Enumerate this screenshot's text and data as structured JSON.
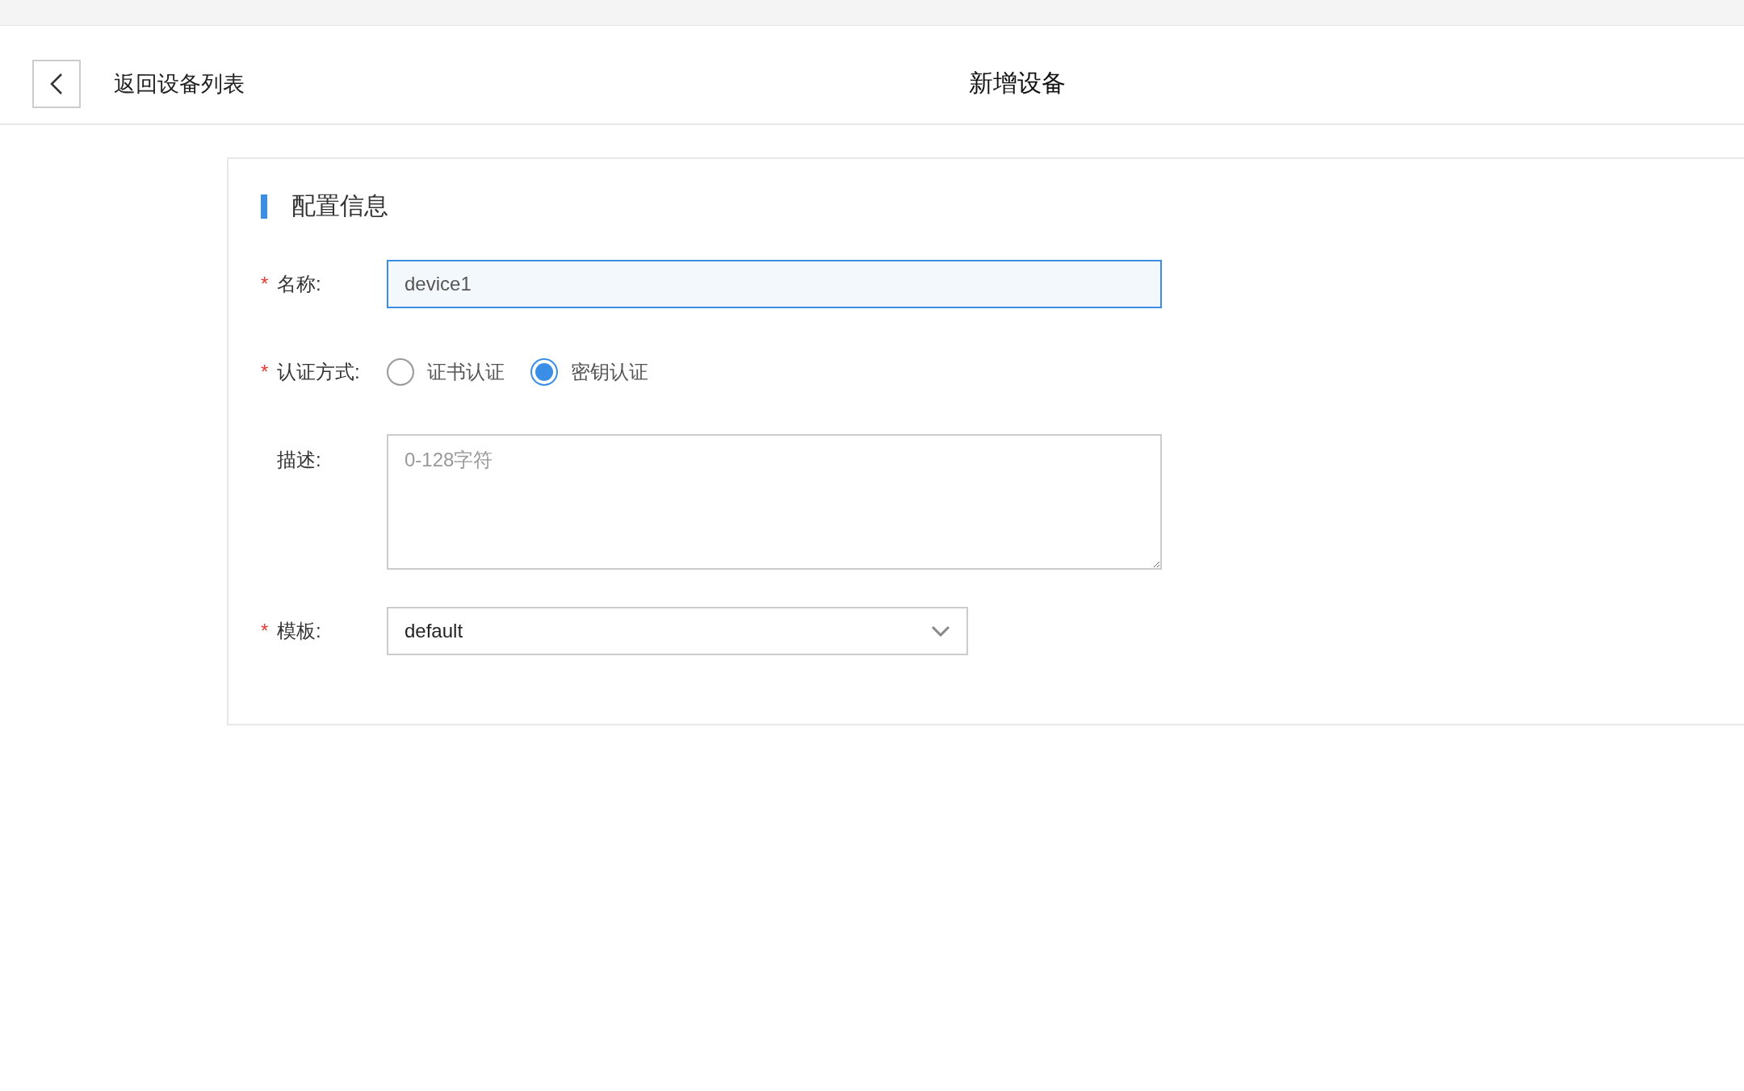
{
  "header": {
    "back_label": "返回设备列表",
    "title": "新增设备"
  },
  "section": {
    "title": "配置信息",
    "fields": [
      {
        "kind": "text",
        "required_mark": "*",
        "label": "名称:",
        "value": "device1"
      },
      {
        "kind": "radio",
        "required_mark": "*",
        "label": "认证方式:",
        "options": [
          {
            "label": "证书认证",
            "selected": false
          },
          {
            "label": "密钥认证",
            "selected": true
          }
        ]
      },
      {
        "kind": "textarea",
        "label": "描述:",
        "placeholder": "0-128字符"
      },
      {
        "kind": "select",
        "required_mark": "*",
        "label": "模板:",
        "value": "default"
      }
    ]
  }
}
